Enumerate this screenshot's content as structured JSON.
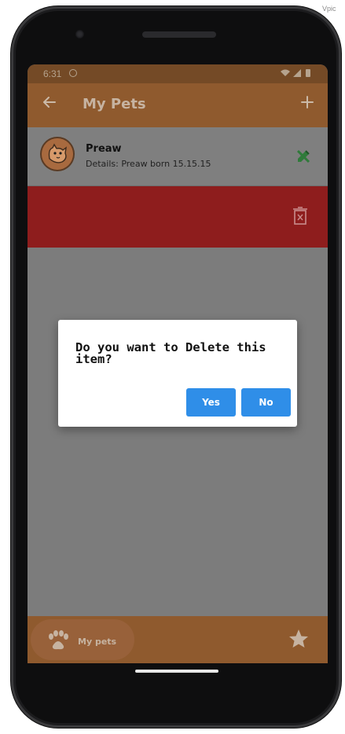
{
  "corner": {
    "text": "Vpic"
  },
  "status_bar": {
    "time": "6:31"
  },
  "app_bar": {
    "title": "My Pets"
  },
  "pet_list": [
    {
      "name": "Preaw",
      "details": "Details: Preaw born 15.15.15"
    }
  ],
  "dialog": {
    "message": "Do you want to Delete this item?",
    "yes_label": "Yes",
    "no_label": "No"
  },
  "bottom_nav": {
    "my_pets_label": "My pets"
  },
  "colors": {
    "app_bar": "#8f5a2e",
    "delete_bar": "#8e1d1d",
    "button": "#2f8ee8",
    "edit_icon": "#2f7a3a"
  },
  "icons": {
    "back": "arrow-left-icon",
    "add": "plus-icon",
    "edit": "pencil-icon",
    "delete": "trash-icon",
    "nav": "paw-icon",
    "favorite": "star-icon"
  }
}
